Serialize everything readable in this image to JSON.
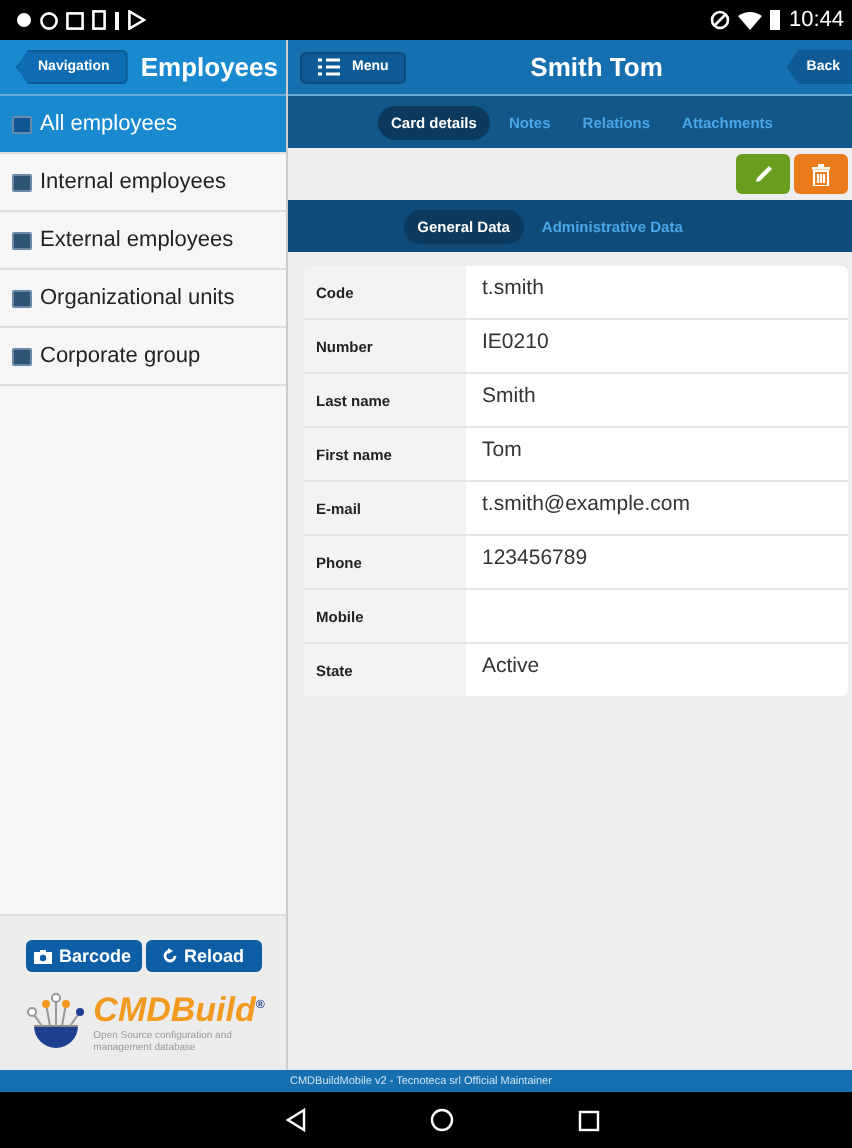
{
  "status_bar": {
    "time": "10:44"
  },
  "sidebar": {
    "back_button": "Navigation",
    "title": "Employees",
    "items": [
      {
        "label": "All employees",
        "selected": true
      },
      {
        "label": "Internal employees",
        "selected": false
      },
      {
        "label": "External employees",
        "selected": false
      },
      {
        "label": "Organizational units",
        "selected": false
      },
      {
        "label": "Corporate group",
        "selected": false
      }
    ],
    "buttons": [
      {
        "kind": "barcode",
        "label": "Barcode"
      },
      {
        "kind": "reload",
        "label": "Reload"
      }
    ],
    "logo": {
      "name": "CMDBuild$^{®}$",
      "tagline": "Open Source configuration and management database"
    }
  },
  "header": {
    "menu_button": "Menu",
    "title": "Smith Tom",
    "back_button": "Back"
  },
  "tabs": [
    {
      "label": "Card details",
      "selected": true
    },
    {
      "label": "Notes",
      "selected": false
    },
    {
      "label": "Relations",
      "selected": false
    },
    {
      "label": "Attachments",
      "selected": false
    }
  ],
  "actions": [
    {
      "kind": "edit"
    },
    {
      "kind": "delete"
    }
  ],
  "subtabs": [
    {
      "label": "General Data",
      "selected": true
    },
    {
      "label": "Administrative Data",
      "selected": false
    }
  ],
  "fields": [
    {
      "label": "Code",
      "value": "t.smith"
    },
    {
      "label": "Number",
      "value": "IE0210"
    },
    {
      "label": "Last name",
      "value": "Smith"
    },
    {
      "label": "First name",
      "value": "Tom"
    },
    {
      "label": "E-mail",
      "value": "t.smith@example.com"
    },
    {
      "label": "Phone",
      "value": "123456789"
    },
    {
      "label": "Mobile"
    },
    {
      "label": "State",
      "value": "Active"
    }
  ],
  "footer": "CMDBuildMobile v2 - Tecnoteca srl Official Maintainer"
}
